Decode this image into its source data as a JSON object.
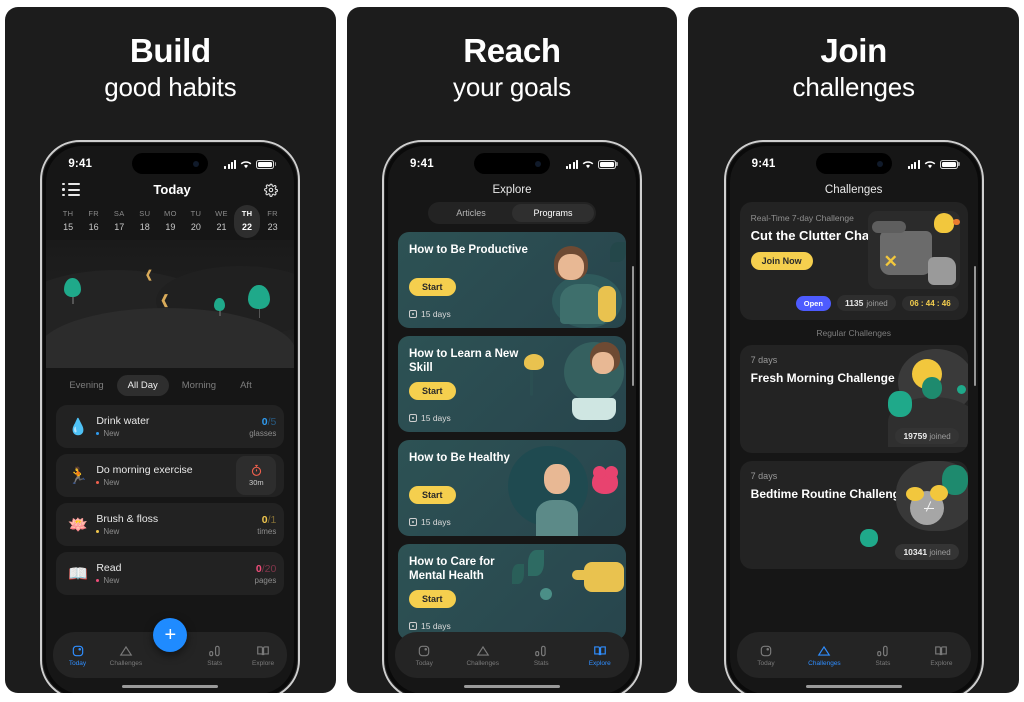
{
  "panels": [
    {
      "heading": "Build",
      "subheading": "good habits",
      "status": {
        "time": "9:41",
        "signal_icon": "cellular-bars-icon",
        "wifi_icon": "wifi-icon",
        "battery_icon": "battery-icon"
      },
      "nav": {
        "menu_icon": "list-menu-icon",
        "title": "Today",
        "settings_icon": "gear-icon"
      },
      "calendar": [
        {
          "dow": "TH",
          "day": "15",
          "selected": false
        },
        {
          "dow": "FR",
          "day": "16",
          "selected": false
        },
        {
          "dow": "SA",
          "day": "17",
          "selected": false
        },
        {
          "dow": "SU",
          "day": "18",
          "selected": false
        },
        {
          "dow": "MO",
          "day": "19",
          "selected": false
        },
        {
          "dow": "TU",
          "day": "20",
          "selected": false
        },
        {
          "dow": "WE",
          "day": "21",
          "selected": false
        },
        {
          "dow": "TH",
          "day": "22",
          "selected": true
        },
        {
          "dow": "FR",
          "day": "23",
          "selected": false
        }
      ],
      "filters": [
        {
          "label": "Evening",
          "active": false
        },
        {
          "label": "All Day",
          "active": true
        },
        {
          "label": "Morning",
          "active": false
        },
        {
          "label": "Aft",
          "active": false
        }
      ],
      "habits": [
        {
          "icon": "water-drop-icon",
          "glyph": "💧",
          "name": "Drink water",
          "status": "New",
          "current": "0",
          "total": "/5",
          "unit": "glasses",
          "color": "#2f9bf0",
          "mode": "count"
        },
        {
          "icon": "running-person-icon",
          "glyph": "🏃",
          "name": "Do morning exercise",
          "status": "New",
          "timer_icon": "stopwatch-icon",
          "timer_value": "30m",
          "color": "#f0604d",
          "mode": "timer"
        },
        {
          "icon": "tooth-icon",
          "glyph": "🦷",
          "name": "Brush & floss",
          "status": "New",
          "current": "0",
          "total": "/1",
          "unit": "times",
          "color": "#f0c64d",
          "mode": "count"
        },
        {
          "icon": "open-book-icon",
          "glyph": "📖",
          "name": "Read",
          "status": "New",
          "current": "0",
          "total": "/20",
          "unit": "pages",
          "color": "#f04d7a",
          "mode": "count"
        }
      ],
      "fab": {
        "icon": "plus-icon",
        "label": "+"
      },
      "tabs": [
        {
          "label": "Today",
          "icon": "today-square-icon",
          "active": true
        },
        {
          "label": "Challenges",
          "icon": "mountain-icon",
          "active": false
        },
        {
          "label": "Stats",
          "icon": "bar-chart-icon",
          "active": false
        },
        {
          "label": "Explore",
          "icon": "book-icon",
          "active": false
        }
      ]
    },
    {
      "heading": "Reach",
      "subheading": "your goals",
      "status": {
        "time": "9:41",
        "signal_icon": "cellular-bars-icon",
        "wifi_icon": "wifi-icon",
        "battery_icon": "battery-icon"
      },
      "nav": {
        "title": "Explore"
      },
      "segments": [
        {
          "label": "Articles",
          "active": false
        },
        {
          "label": "Programs",
          "active": true
        }
      ],
      "programs": [
        {
          "title": "How to Be Productive",
          "button": "Start",
          "days": "15 days",
          "art": "backpack-man-illustration"
        },
        {
          "title": "How to Learn a New Skill",
          "button": "Start",
          "days": "15 days",
          "art": "reading-lamp-illustration"
        },
        {
          "title": "How to Be Healthy",
          "button": "Start",
          "days": "15 days",
          "art": "woman-heart-illustration"
        },
        {
          "title": "How to Care for Mental Health",
          "button": "Start",
          "days": "15 days",
          "art": "watering-can-illustration"
        }
      ],
      "tabs": [
        {
          "label": "Today",
          "icon": "today-square-icon",
          "active": false
        },
        {
          "label": "Challenges",
          "icon": "mountain-icon",
          "active": false
        },
        {
          "label": "Stats",
          "icon": "bar-chart-icon",
          "active": false
        },
        {
          "label": "Explore",
          "icon": "book-icon",
          "active": true
        }
      ]
    },
    {
      "heading": "Join",
      "subheading": "challenges",
      "status": {
        "time": "9:41",
        "signal_icon": "cellular-bars-icon",
        "wifi_icon": "wifi-icon",
        "battery_icon": "battery-icon"
      },
      "nav": {
        "title": "Challenges"
      },
      "featured": {
        "kicker": "Real-Time 7-day Challenge",
        "title": "Cut the Clutter Challenge",
        "button": "Join Now",
        "badge": "Open",
        "joined_count": "1135",
        "joined_label": "joined",
        "countdown": "06 : 44 : 46",
        "art": "laundry-basket-duck-illustration"
      },
      "section_title": "Regular Challenges",
      "challenges": [
        {
          "days": "7 days",
          "title": "Fresh Morning Challenge",
          "joined_count": "19759",
          "joined_label": "joined",
          "art": "sunrise-illustration"
        },
        {
          "days": "7 days",
          "title": "Bedtime Routine Challenge",
          "joined_count": "10341",
          "joined_label": "joined",
          "art": "alarm-clock-illustration"
        }
      ],
      "tabs": [
        {
          "label": "Today",
          "icon": "today-square-icon",
          "active": false
        },
        {
          "label": "Challenges",
          "icon": "mountain-icon",
          "active": true
        },
        {
          "label": "Stats",
          "icon": "bar-chart-icon",
          "active": false
        },
        {
          "label": "Explore",
          "icon": "book-icon",
          "active": false
        }
      ]
    }
  ],
  "colors": {
    "page_bg": "#ffffff",
    "panel_bg": "#1c1c1c",
    "screen_bg": "#161616",
    "accent_blue": "#1f8bff",
    "accent_yellow": "#f5cf4e",
    "accent_purple": "#4d5bff",
    "card_teal": "#2d5254",
    "green": "#1fa98a"
  }
}
